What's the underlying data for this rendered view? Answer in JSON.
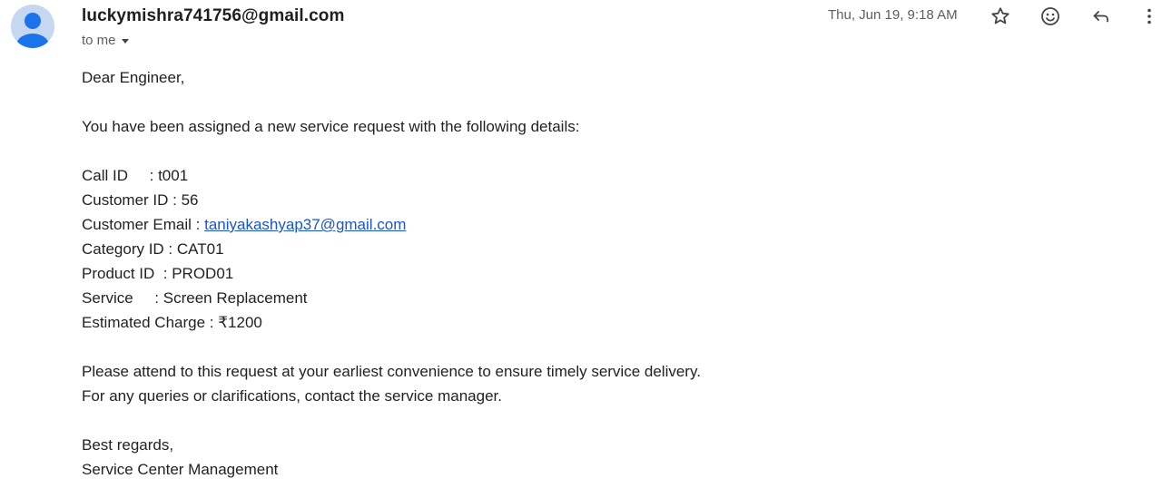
{
  "message": {
    "sender": "luckymishra741756@gmail.com",
    "recipient_label": "to me",
    "date": "Thu, Jun 19, 9:18 AM"
  },
  "actions": {
    "star_icon": "star-icon",
    "emoji_icon": "emoji-reaction-icon",
    "reply_icon": "reply-icon",
    "more_icon": "more-vertical-icon"
  },
  "body": {
    "greeting": "Dear Engineer,",
    "intro": "You have been assigned a new service request with the following details:",
    "call_id": "Call ID     : t001",
    "customer_id": "Customer ID : 56",
    "customer_email_label": "Customer Email : ",
    "customer_email": "taniyakashyap37@gmail.com",
    "category_id": "Category ID : CAT01",
    "product_id": "Product ID  : PROD01",
    "service": "Service     : Screen Replacement",
    "estimated_charge": "Estimated Charge : ₹1200",
    "request_line": "Please attend to this request at your earliest convenience to ensure timely service delivery.",
    "queries_line": "For any queries or clarifications, contact the service manager.",
    "closing": "Best regards,",
    "signature": "Service Center Management"
  },
  "colors": {
    "avatar_bg": "#c6d7f2",
    "avatar_fg": "#1a73e8",
    "link": "#1a55c9"
  }
}
